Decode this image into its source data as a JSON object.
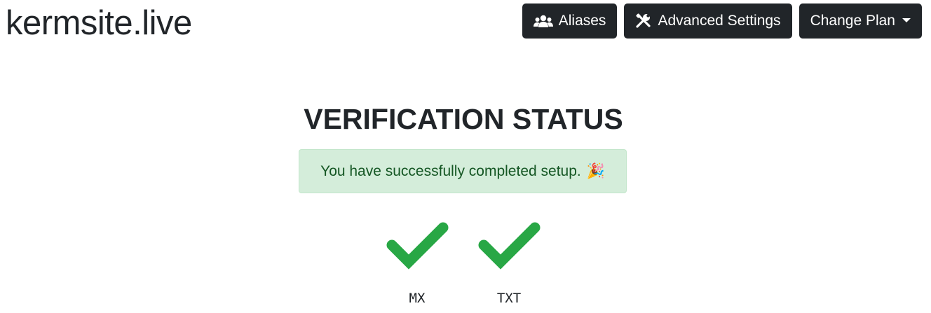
{
  "header": {
    "site_title": "kermsite.live"
  },
  "toolbar": {
    "aliases_label": "Aliases",
    "advanced_settings_label": "Advanced Settings",
    "change_plan_label": "Change Plan"
  },
  "main": {
    "heading": "VERIFICATION STATUS",
    "alert_text": "You have successfully completed setup.",
    "alert_emoji": "🎉",
    "checks": [
      {
        "label": "MX",
        "status": "verified",
        "icon": "check-icon",
        "color": "#28a745"
      },
      {
        "label": "TXT",
        "status": "verified",
        "icon": "check-icon",
        "color": "#28a745"
      }
    ]
  },
  "colors": {
    "button_bg": "#212529",
    "alert_bg": "#d4edda",
    "alert_text": "#155724",
    "success": "#28a745"
  }
}
